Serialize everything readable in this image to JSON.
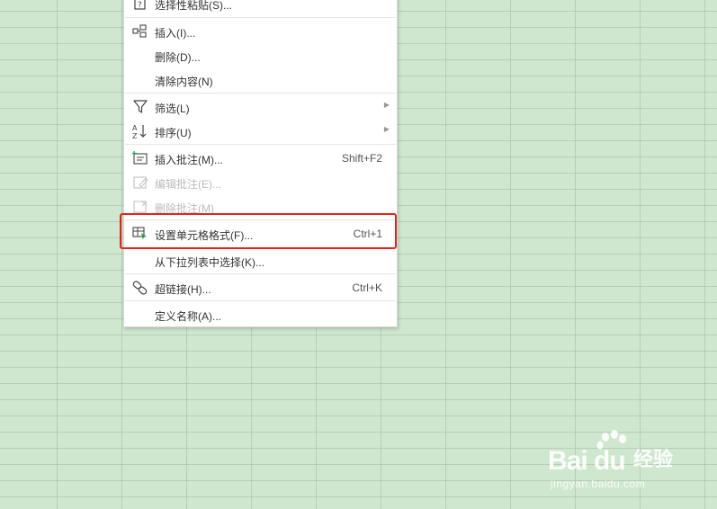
{
  "context_menu": {
    "items": [
      {
        "label": "选择性粘贴(S)...",
        "icon": "paste-special-icon"
      },
      {
        "label": "插入(I)...",
        "icon": "insert-icon"
      },
      {
        "label": "删除(D)..."
      },
      {
        "label": "清除内容(N)"
      },
      {
        "label": "筛选(L)",
        "icon": "filter-icon",
        "submenu": true
      },
      {
        "label": "排序(U)",
        "icon": "sort-icon",
        "submenu": true
      },
      {
        "label": "插入批注(M)...",
        "icon": "insert-comment-icon",
        "shortcut": "Shift+F2"
      },
      {
        "label": "编辑批注(E)...",
        "icon": "edit-comment-icon",
        "disabled": true
      },
      {
        "label": "删除批注(M)",
        "icon": "delete-comment-icon",
        "disabled": true
      },
      {
        "label": "设置单元格格式(F)...",
        "icon": "format-cells-icon",
        "shortcut": "Ctrl+1",
        "highlighted": true
      },
      {
        "label": "从下拉列表中选择(K)..."
      },
      {
        "label": "超链接(H)...",
        "icon": "hyperlink-icon",
        "shortcut": "Ctrl+K"
      },
      {
        "label": "定义名称(A)..."
      }
    ]
  },
  "colors": {
    "sheet_background": "#cfe7cf",
    "highlight_border": "#e4231b",
    "icon": "#444444",
    "disabled_text": "#bbbbbb"
  },
  "watermark": {
    "logo": "Bai du",
    "text": "经验",
    "url": "jingyan.baidu.com"
  }
}
